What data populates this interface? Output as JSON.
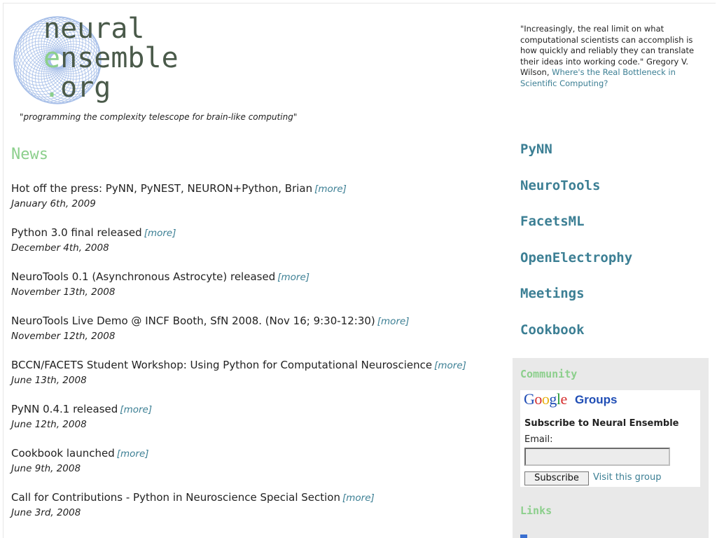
{
  "logo": {
    "line1": "neural",
    "line2_accent": "e",
    "line2_rest": "nsemble",
    "line3_accent": ".",
    "line3_rest": "org"
  },
  "tagline": "\"programming the complexity telescope for brain-like computing\"",
  "quote": {
    "text": "\"Increasingly, the real limit on what computational scientists can accomplish is how quickly and reliably they can translate their ideas into working code.\"",
    "author": "Gregory V. Wilson,",
    "link_text": "Where's the Real Bottleneck in Scientific Computing?"
  },
  "news": {
    "title": "News",
    "more_label": "[more]",
    "items": [
      {
        "headline": "Hot off the press: PyNN, PyNEST, NEURON+Python, Brian",
        "date": "January 6th, 2009"
      },
      {
        "headline": "Python 3.0 final released",
        "date": "December 4th, 2008"
      },
      {
        "headline": "NeuroTools 0.1 (Asynchronous Astrocyte) released",
        "date": "November 13th, 2008"
      },
      {
        "headline": "NeuroTools Live Demo @ INCF Booth, SfN 2008. (Nov 16; 9:30-12:30)",
        "date": "November 12th, 2008"
      },
      {
        "headline": "BCCN/FACETS Student Workshop: Using Python for Computational Neuroscience",
        "date": "June 13th, 2008"
      },
      {
        "headline": "PyNN 0.4.1 released",
        "date": "June 12th, 2008"
      },
      {
        "headline": "Cookbook launched",
        "date": "June 9th, 2008"
      },
      {
        "headline": "Call for Contributions - Python in Neuroscience Special Section",
        "date": "June 3rd, 2008"
      }
    ]
  },
  "nav": {
    "items": [
      "PyNN",
      "NeuroTools",
      "FacetsML",
      "OpenElectrophy",
      "Meetings",
      "Cookbook"
    ]
  },
  "community": {
    "title": "Community",
    "google_letters": [
      "G",
      "o",
      "o",
      "g",
      "l",
      "e"
    ],
    "google_colors": [
      "#1f4db5",
      "#d52d2d",
      "#e8b00f",
      "#1f4db5",
      "#2a9a3a",
      "#d52d2d"
    ],
    "groups_label": "Groups",
    "subscribe_heading": "Subscribe to Neural Ensemble",
    "email_label": "Email:",
    "email_value": "",
    "subscribe_button": "Subscribe",
    "visit_link": "Visit this group"
  },
  "links": {
    "title": "Links"
  },
  "colors": {
    "accent_green": "#8ccf8c",
    "link_teal": "#3c7f94",
    "logo_circle": "#9db8e6"
  }
}
